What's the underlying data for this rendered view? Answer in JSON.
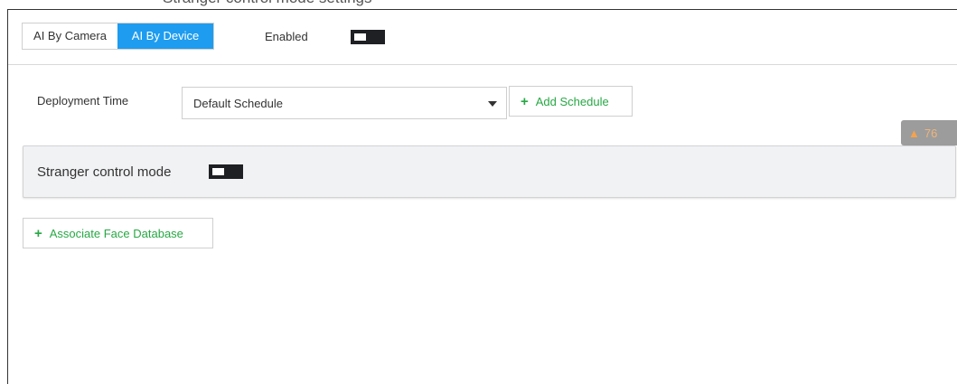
{
  "page_title": "Stranger control mode settings",
  "header": {
    "tabs": [
      {
        "label": "AI By Camera",
        "active": false
      },
      {
        "label": "AI By Device",
        "active": true
      }
    ],
    "enabled_label": "Enabled",
    "enabled_on": false
  },
  "deployment": {
    "label": "Deployment Time",
    "selected": "Default Schedule",
    "add_schedule_label": "Add Schedule"
  },
  "warning_badge": {
    "icon": "warning-triangle-icon",
    "count": "76"
  },
  "stranger": {
    "label": "Stranger control mode",
    "on": false
  },
  "associate_label": "Associate Face Database",
  "colors": {
    "accent": "#1e9cf0",
    "success": "#27a844",
    "toggle_track": "#1f2023",
    "warning": "#f7a24a"
  }
}
